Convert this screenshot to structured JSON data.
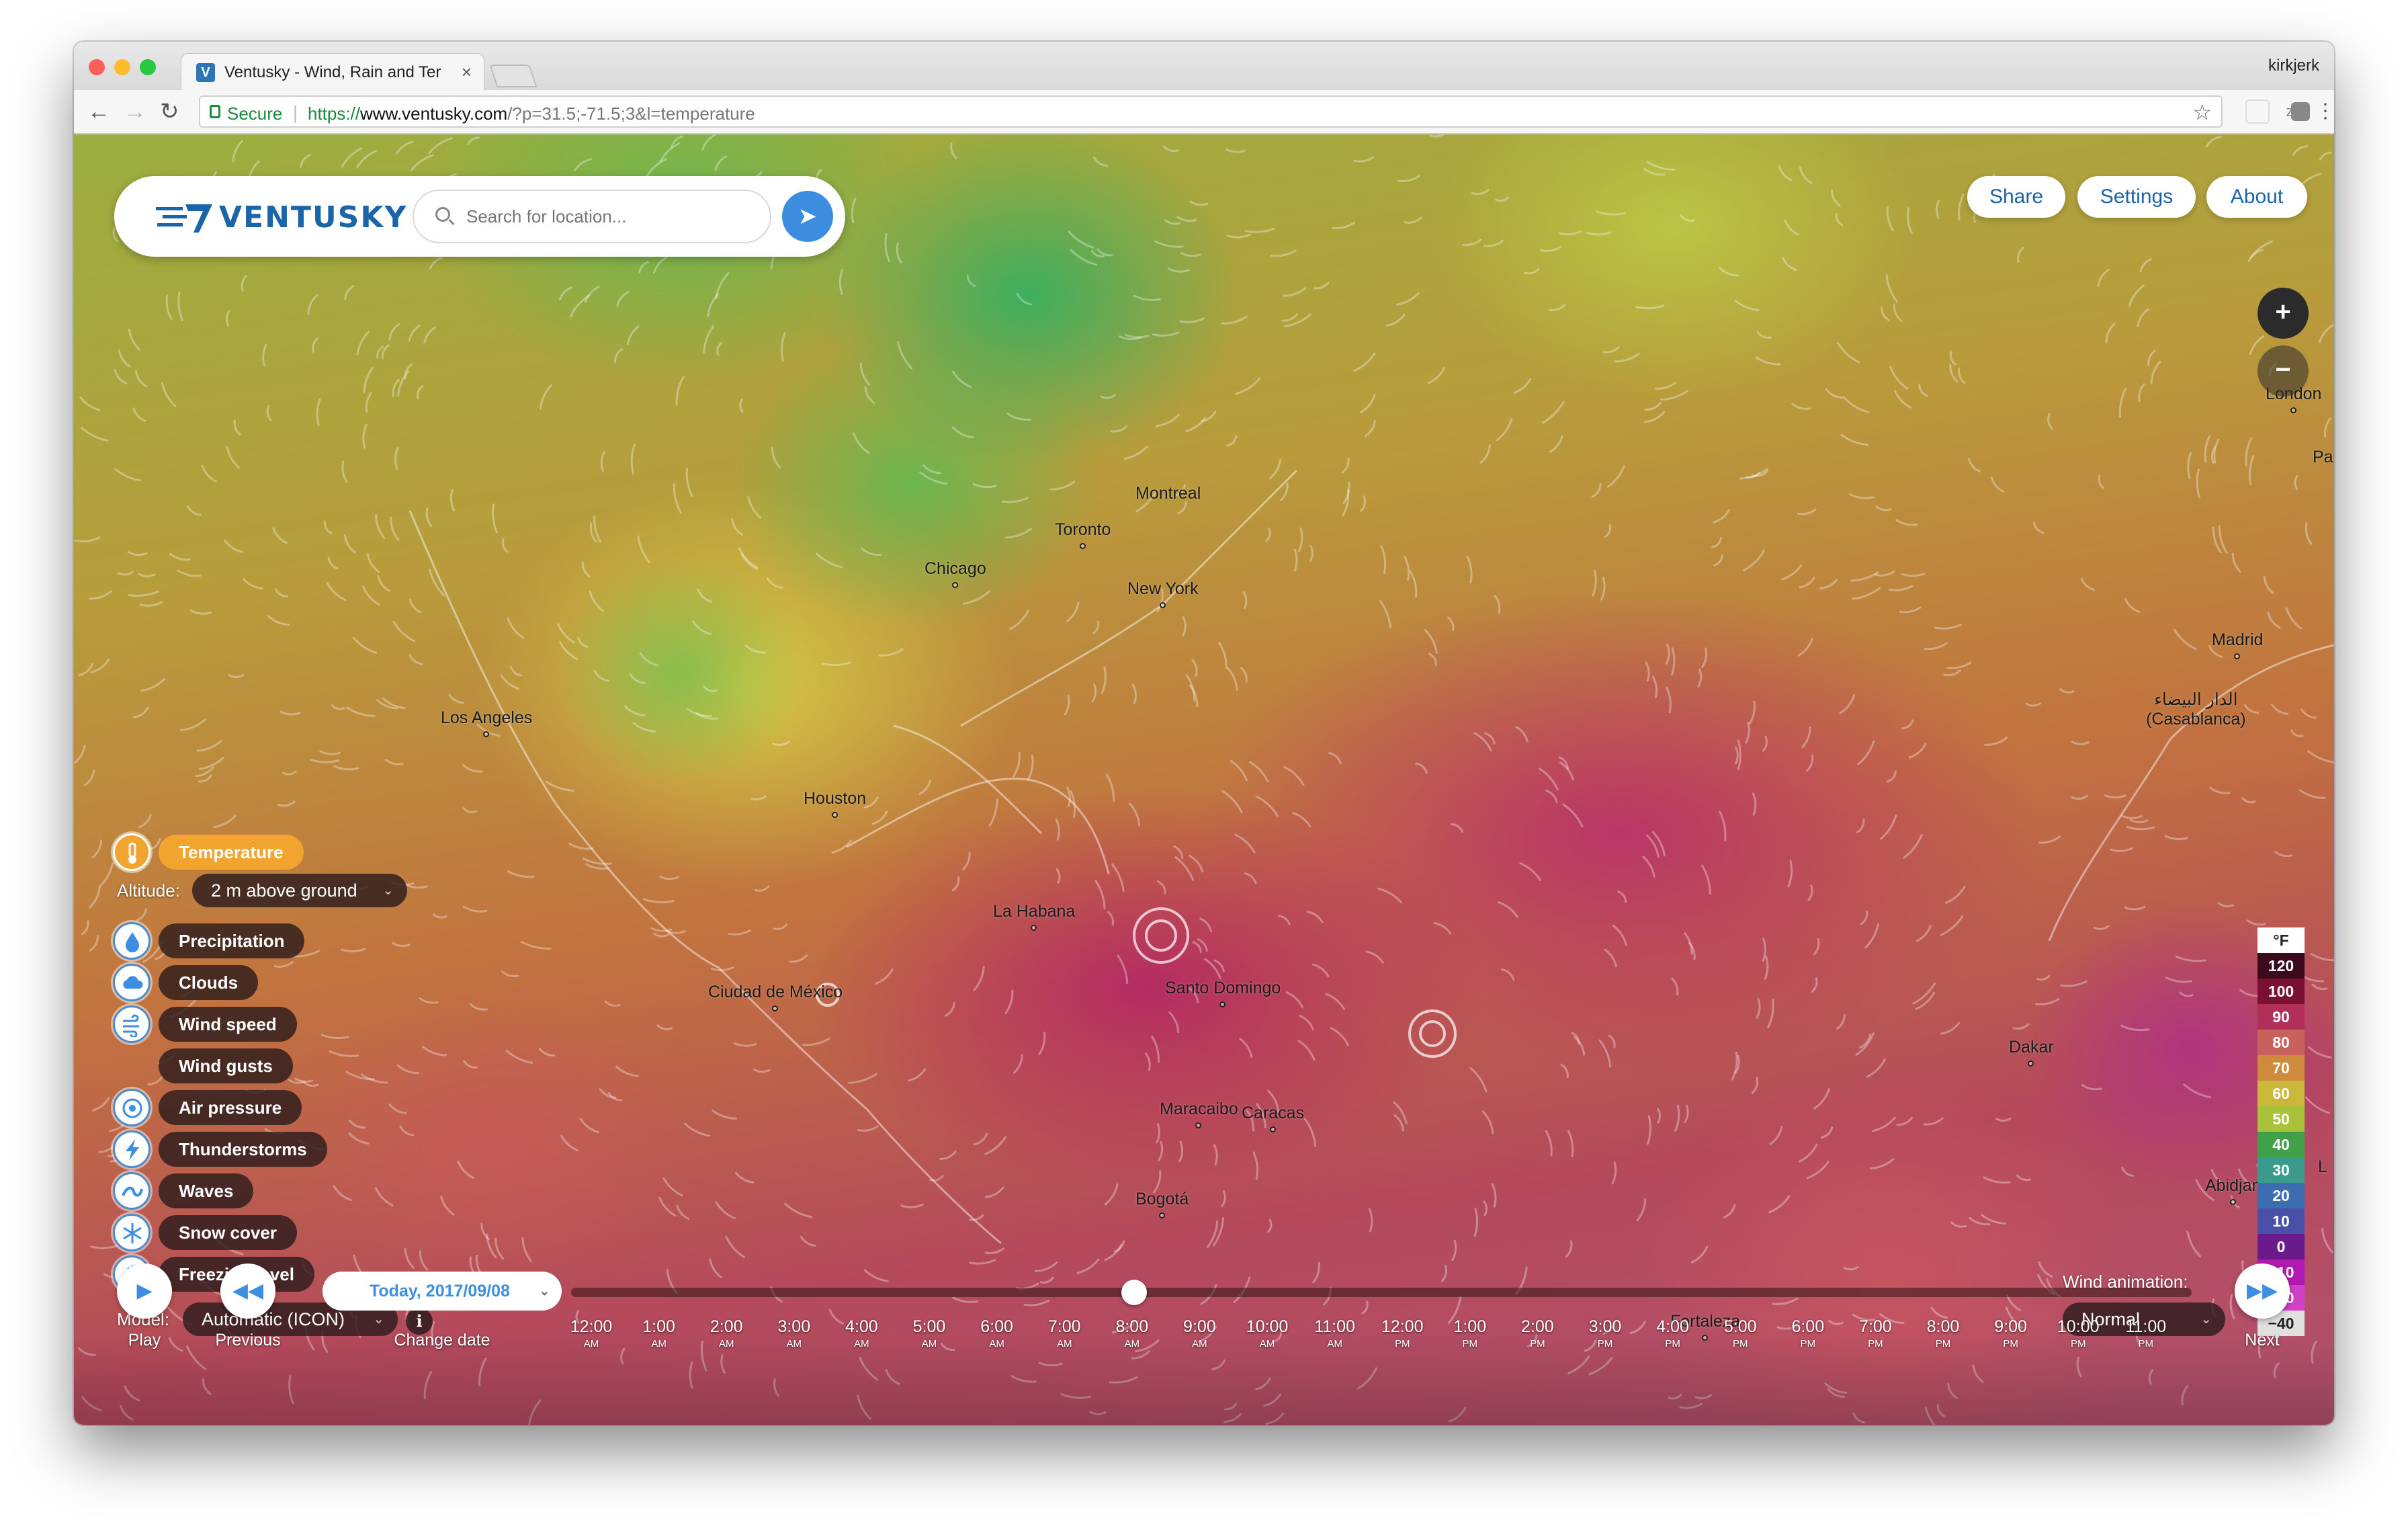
{
  "browser": {
    "tab_title": "Ventusky - Wind, Rain and Ter",
    "tab_close": "×",
    "user": "kirkjerk",
    "secure": "Secure",
    "url_scheme": "https://",
    "url_host": "www.ventusky.com",
    "url_path": "/?p=31.5;-71.5;3&l=temperature",
    "ext_z": "z"
  },
  "brand": {
    "logo_text": "VENTUSKY",
    "search_placeholder": "Search for location..."
  },
  "header_buttons": [
    "Share",
    "Settings",
    "About"
  ],
  "zoom": {
    "plus": "+",
    "minus": "−"
  },
  "layers": {
    "active": "Temperature",
    "altitude_label": "Altitude:",
    "altitude_value": "2 m above ground",
    "items": [
      "Precipitation",
      "Clouds",
      "Wind speed",
      "Wind gusts",
      "Air pressure",
      "Thunderstorms",
      "Waves",
      "Snow cover",
      "Freezing level"
    ],
    "model_label": "Model:",
    "model_value": "Automatic (ICON)"
  },
  "cities": [
    "Montreal",
    "Toronto",
    "Chicago",
    "New York",
    "Los Angeles",
    "Houston",
    "La Habana",
    "Ciudad de México",
    "Santo Domingo",
    "Maracaibo",
    "Caracas",
    "Bogotá",
    "Dakar",
    "Abidjan",
    "Fortaleza",
    "Madrid",
    "الدار البيضاء",
    "(Casablanca)",
    "London",
    "Pa",
    "L"
  ],
  "legend": {
    "unit": "°F",
    "values": [
      "120",
      "100",
      "90",
      "80",
      "70",
      "60",
      "50",
      "40",
      "30",
      "20",
      "10",
      "0",
      "−10",
      "−20",
      "−40"
    ],
    "colors": [
      "#3b0a1c",
      "#7a1032",
      "#b0305a",
      "#c8605c",
      "#d08a3c",
      "#c9b83a",
      "#a8c33a",
      "#3fa24b",
      "#3a9a8c",
      "#3c6db0",
      "#4a4fa8",
      "#6a1a8a",
      "#b01ab0",
      "#d040c8",
      "#e0e0e0"
    ]
  },
  "wind_animation": {
    "label": "Wind animation:",
    "value": "Normal"
  },
  "timeline": {
    "play": "Play",
    "previous": "Previous",
    "change_date": "Change date",
    "next": "Next",
    "date": "Today, 2017/09/08",
    "current_fraction": 0.3475,
    "ticks": [
      {
        "t": "12:00",
        "ap": "AM"
      },
      {
        "t": "1:00",
        "ap": "AM"
      },
      {
        "t": "2:00",
        "ap": "AM"
      },
      {
        "t": "3:00",
        "ap": "AM"
      },
      {
        "t": "4:00",
        "ap": "AM"
      },
      {
        "t": "5:00",
        "ap": "AM"
      },
      {
        "t": "6:00",
        "ap": "AM"
      },
      {
        "t": "7:00",
        "ap": "AM"
      },
      {
        "t": "8:00",
        "ap": "AM"
      },
      {
        "t": "9:00",
        "ap": "AM"
      },
      {
        "t": "10:00",
        "ap": "AM"
      },
      {
        "t": "11:00",
        "ap": "AM"
      },
      {
        "t": "12:00",
        "ap": "PM"
      },
      {
        "t": "1:00",
        "ap": "PM"
      },
      {
        "t": "2:00",
        "ap": "PM"
      },
      {
        "t": "3:00",
        "ap": "PM"
      },
      {
        "t": "4:00",
        "ap": "PM"
      },
      {
        "t": "5:00",
        "ap": "PM"
      },
      {
        "t": "6:00",
        "ap": "PM"
      },
      {
        "t": "7:00",
        "ap": "PM"
      },
      {
        "t": "8:00",
        "ap": "PM"
      },
      {
        "t": "9:00",
        "ap": "PM"
      },
      {
        "t": "10:00",
        "ap": "PM"
      },
      {
        "t": "11:00",
        "ap": "PM"
      }
    ]
  }
}
